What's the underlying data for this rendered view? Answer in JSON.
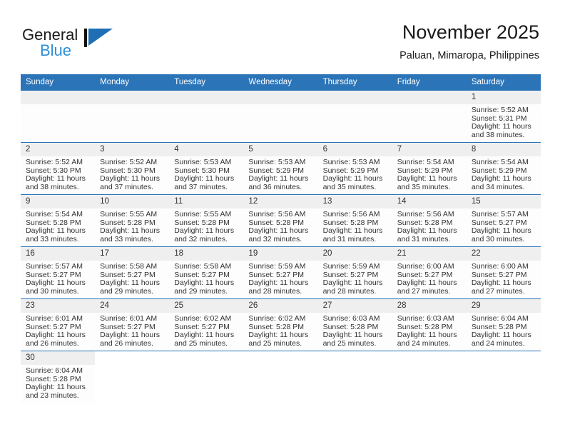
{
  "brand": {
    "name_top": "General",
    "name_bottom": "Blue",
    "accent_color": "#2b74b8",
    "logo_blue": "#2e8fd6"
  },
  "header": {
    "title": "November 2025",
    "subtitle": "Paluan, Mimaropa, Philippines"
  },
  "calendar": {
    "weekday_headers": [
      "Sunday",
      "Monday",
      "Tuesday",
      "Wednesday",
      "Thursday",
      "Friday",
      "Saturday"
    ],
    "header_bg": "#2b74b8",
    "daynum_bg": "#efefef",
    "weeks": [
      [
        {
          "empty": true
        },
        {
          "empty": true
        },
        {
          "empty": true
        },
        {
          "empty": true
        },
        {
          "empty": true
        },
        {
          "empty": true
        },
        {
          "day": "1",
          "sunrise": "Sunrise: 5:52 AM",
          "sunset": "Sunset: 5:31 PM",
          "daylight1": "Daylight: 11 hours",
          "daylight2": "and 38 minutes."
        }
      ],
      [
        {
          "day": "2",
          "sunrise": "Sunrise: 5:52 AM",
          "sunset": "Sunset: 5:30 PM",
          "daylight1": "Daylight: 11 hours",
          "daylight2": "and 38 minutes."
        },
        {
          "day": "3",
          "sunrise": "Sunrise: 5:52 AM",
          "sunset": "Sunset: 5:30 PM",
          "daylight1": "Daylight: 11 hours",
          "daylight2": "and 37 minutes."
        },
        {
          "day": "4",
          "sunrise": "Sunrise: 5:53 AM",
          "sunset": "Sunset: 5:30 PM",
          "daylight1": "Daylight: 11 hours",
          "daylight2": "and 37 minutes."
        },
        {
          "day": "5",
          "sunrise": "Sunrise: 5:53 AM",
          "sunset": "Sunset: 5:29 PM",
          "daylight1": "Daylight: 11 hours",
          "daylight2": "and 36 minutes."
        },
        {
          "day": "6",
          "sunrise": "Sunrise: 5:53 AM",
          "sunset": "Sunset: 5:29 PM",
          "daylight1": "Daylight: 11 hours",
          "daylight2": "and 35 minutes."
        },
        {
          "day": "7",
          "sunrise": "Sunrise: 5:54 AM",
          "sunset": "Sunset: 5:29 PM",
          "daylight1": "Daylight: 11 hours",
          "daylight2": "and 35 minutes."
        },
        {
          "day": "8",
          "sunrise": "Sunrise: 5:54 AM",
          "sunset": "Sunset: 5:29 PM",
          "daylight1": "Daylight: 11 hours",
          "daylight2": "and 34 minutes."
        }
      ],
      [
        {
          "day": "9",
          "sunrise": "Sunrise: 5:54 AM",
          "sunset": "Sunset: 5:28 PM",
          "daylight1": "Daylight: 11 hours",
          "daylight2": "and 33 minutes."
        },
        {
          "day": "10",
          "sunrise": "Sunrise: 5:55 AM",
          "sunset": "Sunset: 5:28 PM",
          "daylight1": "Daylight: 11 hours",
          "daylight2": "and 33 minutes."
        },
        {
          "day": "11",
          "sunrise": "Sunrise: 5:55 AM",
          "sunset": "Sunset: 5:28 PM",
          "daylight1": "Daylight: 11 hours",
          "daylight2": "and 32 minutes."
        },
        {
          "day": "12",
          "sunrise": "Sunrise: 5:56 AM",
          "sunset": "Sunset: 5:28 PM",
          "daylight1": "Daylight: 11 hours",
          "daylight2": "and 32 minutes."
        },
        {
          "day": "13",
          "sunrise": "Sunrise: 5:56 AM",
          "sunset": "Sunset: 5:28 PM",
          "daylight1": "Daylight: 11 hours",
          "daylight2": "and 31 minutes."
        },
        {
          "day": "14",
          "sunrise": "Sunrise: 5:56 AM",
          "sunset": "Sunset: 5:28 PM",
          "daylight1": "Daylight: 11 hours",
          "daylight2": "and 31 minutes."
        },
        {
          "day": "15",
          "sunrise": "Sunrise: 5:57 AM",
          "sunset": "Sunset: 5:27 PM",
          "daylight1": "Daylight: 11 hours",
          "daylight2": "and 30 minutes."
        }
      ],
      [
        {
          "day": "16",
          "sunrise": "Sunrise: 5:57 AM",
          "sunset": "Sunset: 5:27 PM",
          "daylight1": "Daylight: 11 hours",
          "daylight2": "and 30 minutes."
        },
        {
          "day": "17",
          "sunrise": "Sunrise: 5:58 AM",
          "sunset": "Sunset: 5:27 PM",
          "daylight1": "Daylight: 11 hours",
          "daylight2": "and 29 minutes."
        },
        {
          "day": "18",
          "sunrise": "Sunrise: 5:58 AM",
          "sunset": "Sunset: 5:27 PM",
          "daylight1": "Daylight: 11 hours",
          "daylight2": "and 29 minutes."
        },
        {
          "day": "19",
          "sunrise": "Sunrise: 5:59 AM",
          "sunset": "Sunset: 5:27 PM",
          "daylight1": "Daylight: 11 hours",
          "daylight2": "and 28 minutes."
        },
        {
          "day": "20",
          "sunrise": "Sunrise: 5:59 AM",
          "sunset": "Sunset: 5:27 PM",
          "daylight1": "Daylight: 11 hours",
          "daylight2": "and 28 minutes."
        },
        {
          "day": "21",
          "sunrise": "Sunrise: 6:00 AM",
          "sunset": "Sunset: 5:27 PM",
          "daylight1": "Daylight: 11 hours",
          "daylight2": "and 27 minutes."
        },
        {
          "day": "22",
          "sunrise": "Sunrise: 6:00 AM",
          "sunset": "Sunset: 5:27 PM",
          "daylight1": "Daylight: 11 hours",
          "daylight2": "and 27 minutes."
        }
      ],
      [
        {
          "day": "23",
          "sunrise": "Sunrise: 6:01 AM",
          "sunset": "Sunset: 5:27 PM",
          "daylight1": "Daylight: 11 hours",
          "daylight2": "and 26 minutes."
        },
        {
          "day": "24",
          "sunrise": "Sunrise: 6:01 AM",
          "sunset": "Sunset: 5:27 PM",
          "daylight1": "Daylight: 11 hours",
          "daylight2": "and 26 minutes."
        },
        {
          "day": "25",
          "sunrise": "Sunrise: 6:02 AM",
          "sunset": "Sunset: 5:27 PM",
          "daylight1": "Daylight: 11 hours",
          "daylight2": "and 25 minutes."
        },
        {
          "day": "26",
          "sunrise": "Sunrise: 6:02 AM",
          "sunset": "Sunset: 5:28 PM",
          "daylight1": "Daylight: 11 hours",
          "daylight2": "and 25 minutes."
        },
        {
          "day": "27",
          "sunrise": "Sunrise: 6:03 AM",
          "sunset": "Sunset: 5:28 PM",
          "daylight1": "Daylight: 11 hours",
          "daylight2": "and 25 minutes."
        },
        {
          "day": "28",
          "sunrise": "Sunrise: 6:03 AM",
          "sunset": "Sunset: 5:28 PM",
          "daylight1": "Daylight: 11 hours",
          "daylight2": "and 24 minutes."
        },
        {
          "day": "29",
          "sunrise": "Sunrise: 6:04 AM",
          "sunset": "Sunset: 5:28 PM",
          "daylight1": "Daylight: 11 hours",
          "daylight2": "and 24 minutes."
        }
      ],
      [
        {
          "day": "30",
          "sunrise": "Sunrise: 6:04 AM",
          "sunset": "Sunset: 5:28 PM",
          "daylight1": "Daylight: 11 hours",
          "daylight2": "and 23 minutes."
        },
        {
          "blank": true
        },
        {
          "blank": true
        },
        {
          "blank": true
        },
        {
          "blank": true
        },
        {
          "blank": true
        },
        {
          "blank": true
        }
      ]
    ]
  }
}
